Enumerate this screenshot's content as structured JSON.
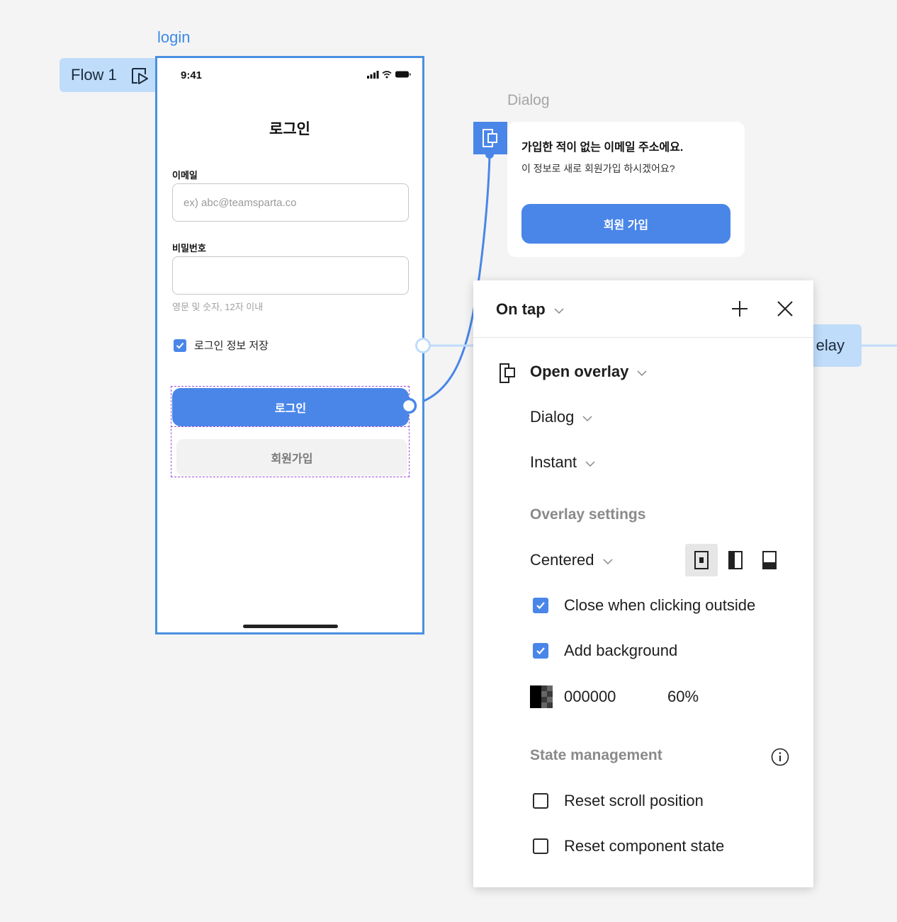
{
  "flow_tag": {
    "label": "Flow 1"
  },
  "frame_label": "login",
  "phone": {
    "status_time": "9:41",
    "title": "로그인",
    "email_label": "이메일",
    "email_placeholder": "ex) abc@teamsparta.co",
    "password_label": "비밀번호",
    "password_hint": "영문 및 숫자, 12자 이내",
    "remember_label": "로그인 정보 저장",
    "remember_checked": true,
    "login_button": "로그인",
    "signup_button": "회원가입"
  },
  "dialog_frame": {
    "label": "Dialog",
    "title": "가입한 적이 없는 이메일 주소에요.",
    "subtitle": "이 정보로 새로 회원가입 하시겠어요?",
    "button": "회원 가입"
  },
  "overlay_tag": {
    "label": "elay"
  },
  "panel": {
    "trigger": "On tap",
    "action": "Open overlay",
    "destination": "Dialog",
    "animation": "Instant",
    "overlay_settings_title": "Overlay settings",
    "position": "Centered",
    "close_outside_label": "Close when clicking outside",
    "close_outside_checked": true,
    "add_background_label": "Add background",
    "add_background_checked": true,
    "background_color_hex": "000000",
    "background_opacity": "60%",
    "state_management_title": "State management",
    "reset_scroll_label": "Reset scroll position",
    "reset_scroll_checked": false,
    "reset_component_label": "Reset component state",
    "reset_component_checked": false
  },
  "colors": {
    "accent": "#4a86e8",
    "frame_outline": "#4a90e2",
    "selection_dashed": "#9a4fd8",
    "flow_tag_bg": "#bfdcfa"
  }
}
